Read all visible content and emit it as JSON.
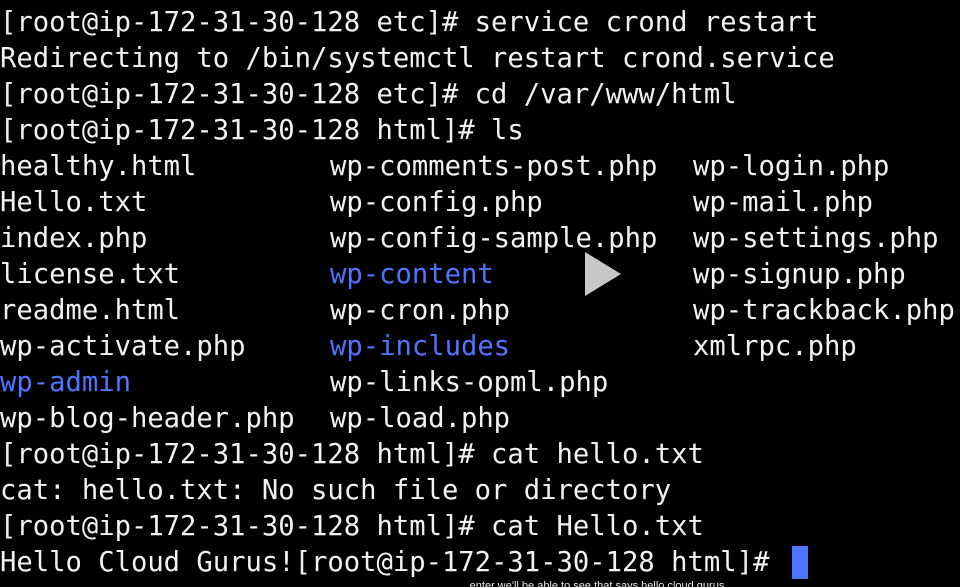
{
  "terminal": {
    "lines": [
      "[root@ip-172-31-30-128 etc]# service crond restart",
      "Redirecting to /bin/systemctl restart crond.service",
      "[root@ip-172-31-30-128 etc]# cd /var/www/html",
      "[root@ip-172-31-30-128 html]# ls"
    ],
    "ls_rows": [
      [
        "healthy.html",
        "wp-comments-post.php",
        "wp-login.php"
      ],
      [
        "Hello.txt",
        "wp-config.php",
        "wp-mail.php"
      ],
      [
        "index.php",
        "wp-config-sample.php",
        "wp-settings.php"
      ],
      [
        "license.txt",
        "wp-content",
        "wp-signup.php"
      ],
      [
        "readme.html",
        "wp-cron.php",
        "wp-trackback.php"
      ],
      [
        "wp-activate.php",
        "wp-includes",
        "xmlrpc.php"
      ],
      [
        "wp-admin",
        "wp-links-opml.php",
        ""
      ],
      [
        "wp-blog-header.php",
        "wp-load.php",
        ""
      ]
    ],
    "after_lines": [
      "[root@ip-172-31-30-128 html]# cat hello.txt",
      "cat: hello.txt: No such file or directory",
      "[root@ip-172-31-30-128 html]# cat Hello.txt"
    ],
    "last_line": "Hello Cloud Gurus![root@ip-172-31-30-128 html]# ",
    "directory_color": "#4f74ff",
    "text_color": "#f2f2f2",
    "background": "#000000"
  },
  "video": {
    "play_icon": "play-icon",
    "caption": "enter we'll be able to see that says hello cloud gurus"
  }
}
